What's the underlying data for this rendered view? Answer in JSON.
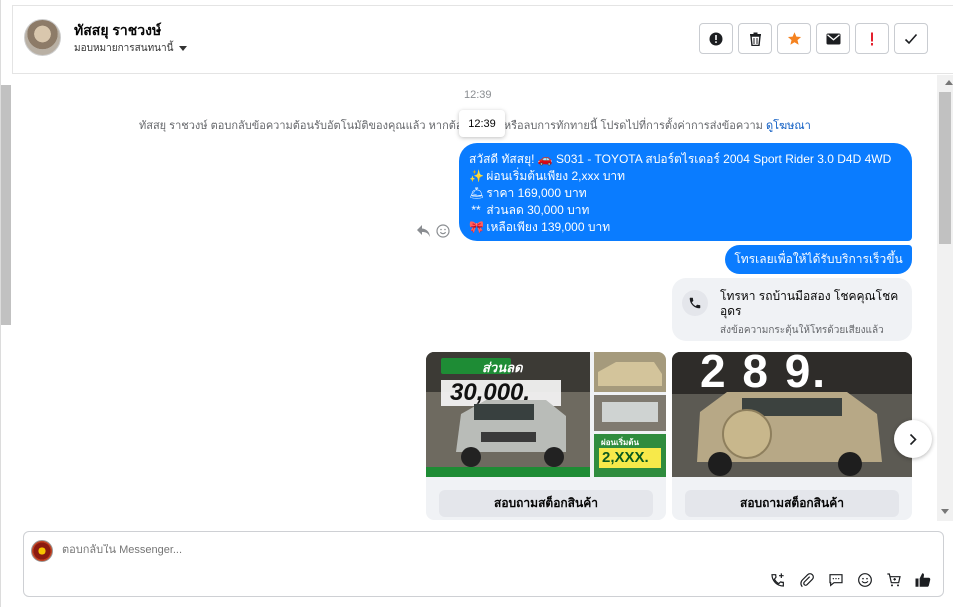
{
  "header": {
    "contact_name": "ทัสสยุ ราชวงษ์",
    "assign_label": "มอบหมายการสนทนานี้",
    "actions": [
      {
        "name": "mark-spam-icon",
        "label": ""
      },
      {
        "name": "delete-icon",
        "label": ""
      },
      {
        "name": "star-icon",
        "label": ""
      },
      {
        "name": "mark-unread-icon",
        "label": ""
      },
      {
        "name": "important-icon",
        "label": ""
      },
      {
        "name": "done-icon",
        "label": ""
      }
    ]
  },
  "chat": {
    "timestamp": "12:39",
    "tooltip_time": "12:39",
    "system_note_before": "ทัสสยุ ราชวงษ์ ตอบกลับข้อความต้อนรับอัตโนมัติของคุณแล้ว หากต้อง",
    "system_note_after": "หรือลบการทักทายนี้ โปรดไปที่การตั้งค่าการส่งข้อความ",
    "system_note_link": "ดูโฆษณา",
    "main_message_lines": [
      {
        "emoji": "",
        "text": "สวัสดี ทัสสยุ! 🚗 S031 - TOYOTA สปอร์ตไรเดอร์ 2004 Sport Rider 3.0 D4D 4WD"
      },
      {
        "emoji": "✨",
        "text": "ผ่อนเริ่มต้นเพียง 2,xxx บาท"
      },
      {
        "emoji": "🛎",
        "text": "ราคา 169,000 บาท"
      },
      {
        "emoji": "**",
        "text": "ส่วนลด 30,000 บาท"
      },
      {
        "emoji": "🎀",
        "text": "เหลือเพียง 139,000 บาท"
      }
    ],
    "quick_reply": "โทรเลยเพื่อให้ได้รับบริการเร็วขึ้น",
    "call_card": {
      "title": "โทรหา รถบ้านมือสอง โชคคุณโชคอุดร",
      "subtitle": "ส่งข้อความกระตุ้นให้โทรด้วยเสียงแล้ว"
    },
    "product_cards": [
      {
        "overlay_top": "ส่วนลด",
        "overlay_big": "30,000.",
        "overlay_small_label": "ผ่อนเริ่มต้น",
        "overlay_small": "2,XXX.",
        "cta": "สอบถามสต็อกสินค้า"
      },
      {
        "overlay_big": "2 8 9.",
        "cta": "สอบถามสต็อกสินค้า"
      }
    ]
  },
  "composer": {
    "placeholder": "ตอบกลับใน Messenger...",
    "tools": [
      "call-add-icon",
      "attach-icon",
      "saved-reply-icon",
      "emoji-icon",
      "cart-icon",
      "like-icon"
    ]
  },
  "colors": {
    "accent": "#0a7cff",
    "star": "#f5821f",
    "important": "#e4202d"
  }
}
